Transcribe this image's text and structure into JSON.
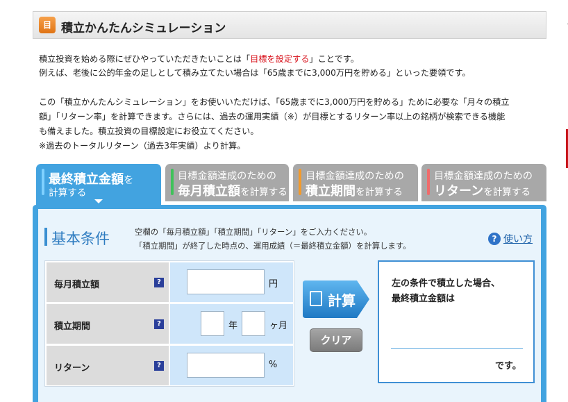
{
  "header": {
    "icon_text": "目",
    "title": "積立かんたんシミュレーション"
  },
  "edge_mark": "ヾ",
  "intro": {
    "line1_a": "積立投資を始める際にぜひやっていただきたいことは「",
    "line1_red": "目標を設定する",
    "line1_b": "」ことです。",
    "line2": "例えば、老後に公的年金の足しとして積み立てたい場合は「65歳までに3,000万円を貯める」といった要領です。",
    "line3": "この「積立かんたんシミュレーション」をお使いいただけば、「65歳までに3,000万円を貯める」ために必要な「月々の積立",
    "line4": "額」「リターン率」を計算できます。さらには、過去の運用実績（※）が目標とするリターン率以上の銘柄が検索できる機能",
    "line5": "も備えました。積立投資の目標設定にお役立てください。",
    "line6": "※過去のトータルリターン（過去3年実績）より計算。"
  },
  "tabs": [
    {
      "big": "最終積立金額",
      "small1": "を",
      "line2": "計算する",
      "active": true
    },
    {
      "line1": "目標金額達成のための",
      "big": "毎月積立額",
      "small": "を計算する",
      "stripe": "#3fc25a"
    },
    {
      "line1": "目標金額達成のための",
      "big": "積立期間",
      "small": "を計算する",
      "stripe": "#f39a2b"
    },
    {
      "line1": "目標金額達成のための",
      "big": "リターン",
      "small": "を計算する",
      "stripe": "#ef6c6c"
    }
  ],
  "conditions": {
    "title": "基本条件",
    "desc1": "空欄の「毎月積立額」「積立期間」「リターン」をご入力ください。",
    "desc2": "「積立期間」が終了した時点の、運用成績（＝最終積立金額）を計算します。",
    "help_link": "使い方"
  },
  "form": {
    "rows": [
      {
        "label": "毎月積立額",
        "unit": "円",
        "value": ""
      },
      {
        "label": "積立期間",
        "unit_year": "年",
        "unit_month": "ヶ月",
        "years": "",
        "months": ""
      },
      {
        "label": "リターン",
        "unit": "%",
        "value": ""
      }
    ],
    "help_glyph": "?"
  },
  "buttons": {
    "calc": "計算",
    "clear": "クリア"
  },
  "result": {
    "line1": "左の条件で積立した場合、",
    "line2": "最終積立金額は",
    "value": "",
    "suffix": "です。"
  },
  "colors": {
    "accent_blue": "#42a3e0",
    "link_red": "#d8101a",
    "tab_gray": "#a8a8a8"
  }
}
